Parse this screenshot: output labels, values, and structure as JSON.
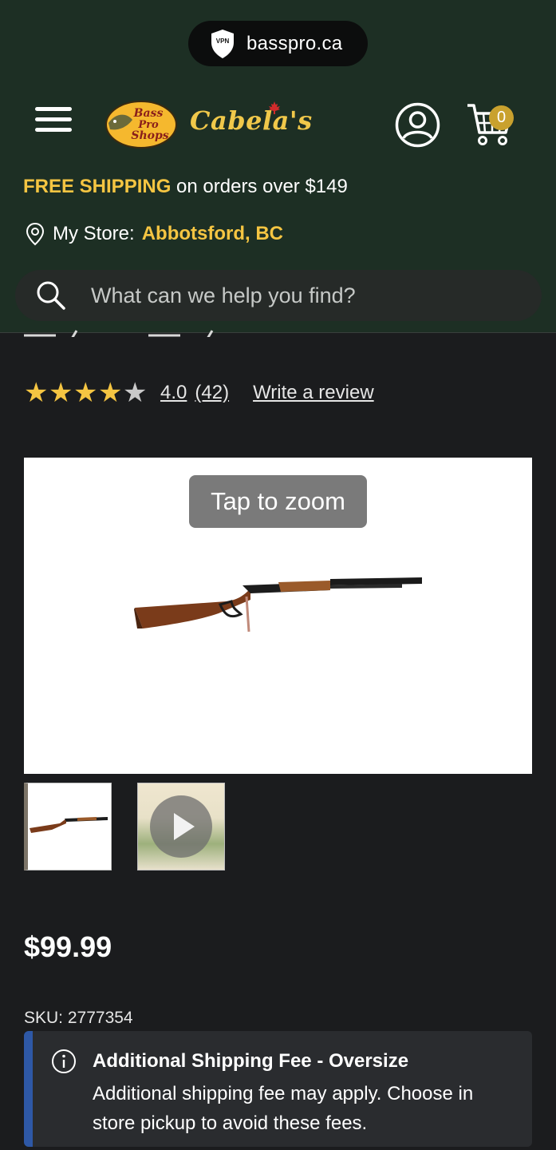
{
  "browser": {
    "url": "basspro.ca",
    "vpn_label": "VPN"
  },
  "header": {
    "logo_primary": [
      "Bass",
      "Pro",
      "Shops"
    ],
    "logo_secondary": "Cabela's",
    "cart_count": "0",
    "shipping": {
      "highlight": "FREE SHIPPING",
      "rest": " on orders over $149"
    },
    "store": {
      "label": "My Store:",
      "value": "Abbotsford, BC"
    },
    "search": {
      "placeholder": "What can we help you find?"
    }
  },
  "product": {
    "rating": {
      "value": "4.0",
      "count": "(42)",
      "stars": 4,
      "max_stars": 5,
      "write_review": "Write a review"
    },
    "zoom_hint": "Tap to zoom",
    "price": "$99.99",
    "sku": "SKU: 2777354",
    "notice": {
      "title": "Additional Shipping Fee - Oversize",
      "body": "Additional shipping fee may apply. Choose in store pickup to avoid these fees.",
      "icon": "info-icon"
    }
  },
  "colors": {
    "header_bg": "#1d2f24",
    "accent_yellow": "#f5c542",
    "page_bg": "#1b1c1e",
    "notice_bar": "#2e58a6",
    "cart_badge": "#c9a12e"
  }
}
